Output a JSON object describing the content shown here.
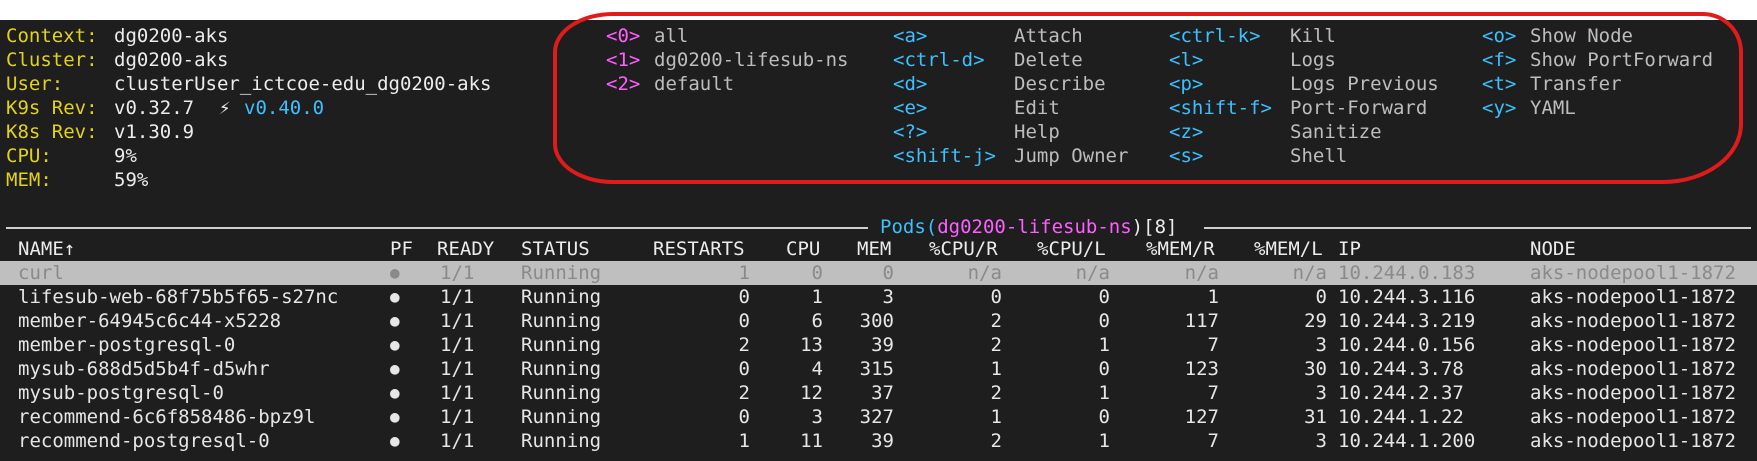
{
  "info": [
    {
      "key": "Context:",
      "value": "dg0200-aks"
    },
    {
      "key": "Cluster:",
      "value": "dg0200-aks"
    },
    {
      "key": "User:",
      "value": "clusterUser_ictcoe-edu_dg0200-aks"
    },
    {
      "key": "K9s Rev:",
      "value": "v0.32.7",
      "upgrade_symbol": "⚡",
      "upgrade_value": "v0.40.0"
    },
    {
      "key": "K8s Rev:",
      "value": "v1.30.9"
    },
    {
      "key": "CPU:",
      "value": "9%"
    },
    {
      "key": "MEM:",
      "value": "59%"
    }
  ],
  "namespaces": [
    {
      "key": "<0>",
      "label": "all"
    },
    {
      "key": "<1>",
      "label": "dg0200-lifesub-ns"
    },
    {
      "key": "<2>",
      "label": "default"
    }
  ],
  "hotkeys_col1": [
    {
      "key": "<a>",
      "label": "Attach"
    },
    {
      "key": "<ctrl-d>",
      "label": "Delete"
    },
    {
      "key": "<d>",
      "label": "Describe"
    },
    {
      "key": "<e>",
      "label": "Edit"
    },
    {
      "key": "<?>",
      "label": "Help"
    },
    {
      "key": "<shift-j>",
      "label": "Jump Owner"
    }
  ],
  "hotkeys_col2": [
    {
      "key": "<ctrl-k>",
      "label": "Kill"
    },
    {
      "key": "<l>",
      "label": "Logs"
    },
    {
      "key": "<p>",
      "label": "Logs Previous"
    },
    {
      "key": "<shift-f>",
      "label": "Port-Forward"
    },
    {
      "key": "<z>",
      "label": "Sanitize"
    },
    {
      "key": "<s>",
      "label": "Shell"
    }
  ],
  "hotkeys_col3": [
    {
      "key": "<o>",
      "label": "Show Node"
    },
    {
      "key": "<f>",
      "label": "Show PortForward"
    },
    {
      "key": "<t>",
      "label": "Transfer"
    },
    {
      "key": "<y>",
      "label": "YAML"
    }
  ],
  "table": {
    "title_prefix": "Pods(",
    "namespace": "dg0200-lifesub-ns",
    "title_mid": ")[",
    "count": "8",
    "title_suffix": "]",
    "headers": {
      "name": "NAME↑",
      "pf": "PF",
      "ready": "READY",
      "status": "STATUS",
      "restarts": "RESTARTS",
      "cpu": "CPU",
      "mem": "MEM",
      "cpu_r": "%CPU/R",
      "cpu_l": "%CPU/L",
      "mem_r": "%MEM/R",
      "mem_l": "%MEM/L",
      "ip": "IP",
      "node": "NODE"
    },
    "rows": [
      {
        "name": "curl",
        "pf": "●",
        "ready": "1/1",
        "status": "Running",
        "restarts": "1",
        "cpu": "0",
        "mem": "0",
        "cpu_r": "n/a",
        "cpu_l": "n/a",
        "mem_r": "n/a",
        "mem_l": "n/a",
        "ip": "10.244.0.183",
        "node": "aks-nodepool1-1872"
      },
      {
        "name": "lifesub-web-68f75b5f65-s27nc",
        "pf": "●",
        "ready": "1/1",
        "status": "Running",
        "restarts": "0",
        "cpu": "1",
        "mem": "3",
        "cpu_r": "0",
        "cpu_l": "0",
        "mem_r": "1",
        "mem_l": "0",
        "ip": "10.244.3.116",
        "node": "aks-nodepool1-1872"
      },
      {
        "name": "member-64945c6c44-x5228",
        "pf": "●",
        "ready": "1/1",
        "status": "Running",
        "restarts": "0",
        "cpu": "6",
        "mem": "300",
        "cpu_r": "2",
        "cpu_l": "0",
        "mem_r": "117",
        "mem_l": "29",
        "ip": "10.244.3.219",
        "node": "aks-nodepool1-1872"
      },
      {
        "name": "member-postgresql-0",
        "pf": "●",
        "ready": "1/1",
        "status": "Running",
        "restarts": "2",
        "cpu": "13",
        "mem": "39",
        "cpu_r": "2",
        "cpu_l": "1",
        "mem_r": "7",
        "mem_l": "3",
        "ip": "10.244.0.156",
        "node": "aks-nodepool1-1872"
      },
      {
        "name": "mysub-688d5d5b4f-d5whr",
        "pf": "●",
        "ready": "1/1",
        "status": "Running",
        "restarts": "0",
        "cpu": "4",
        "mem": "315",
        "cpu_r": "1",
        "cpu_l": "0",
        "mem_r": "123",
        "mem_l": "30",
        "ip": "10.244.3.78",
        "node": "aks-nodepool1-1872"
      },
      {
        "name": "mysub-postgresql-0",
        "pf": "●",
        "ready": "1/1",
        "status": "Running",
        "restarts": "2",
        "cpu": "12",
        "mem": "37",
        "cpu_r": "2",
        "cpu_l": "1",
        "mem_r": "7",
        "mem_l": "3",
        "ip": "10.244.2.37",
        "node": "aks-nodepool1-1872"
      },
      {
        "name": "recommend-6c6f858486-bpz9l",
        "pf": "●",
        "ready": "1/1",
        "status": "Running",
        "restarts": "0",
        "cpu": "3",
        "mem": "327",
        "cpu_r": "1",
        "cpu_l": "0",
        "mem_r": "127",
        "mem_l": "31",
        "ip": "10.244.1.22",
        "node": "aks-nodepool1-1872"
      },
      {
        "name": "recommend-postgresql-0",
        "pf": "●",
        "ready": "1/1",
        "status": "Running",
        "restarts": "1",
        "cpu": "11",
        "mem": "39",
        "cpu_r": "2",
        "cpu_l": "1",
        "mem_r": "7",
        "mem_l": "3",
        "ip": "10.244.1.200",
        "node": "aks-nodepool1-1872"
      }
    ]
  },
  "colors": {
    "background": "#1e1e1e",
    "label": "#e3d21b",
    "hotkey": "#3cc0ff",
    "namespace_key": "#ff5fff",
    "annotation": "#e01b1b",
    "selected_row": "#bfbfbf"
  }
}
